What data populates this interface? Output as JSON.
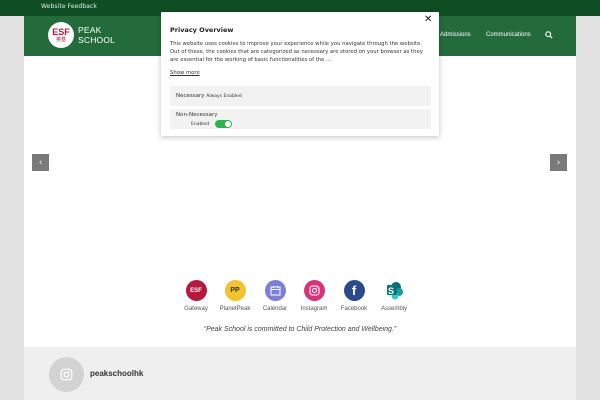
{
  "topbar": {
    "feedback_link": "Website Feedback"
  },
  "header": {
    "logo": {
      "abbr": "ESF",
      "chinese": "英基",
      "name_line1": "PEAK",
      "name_line2": "SCHOOL"
    },
    "nav": [
      {
        "label": "Admissions"
      },
      {
        "label": "Communications"
      }
    ]
  },
  "slider": {
    "prev": "‹",
    "next": "›"
  },
  "privacy_modal": {
    "title": "Privacy Overview",
    "close": "✕",
    "description": "This website uses cookies to improve your experience while you navigate through the website. Out of these, the cookies that are categorized as necessary are stored on your browser as they are essential for the working of basic functionalities of the ...",
    "show_more": "Show more",
    "preferences": [
      {
        "name": "Necessary",
        "status": "Always Enabled"
      },
      {
        "name": "Non-Necessary",
        "status": "Enabled",
        "toggle_on": true
      }
    ]
  },
  "quicklinks": [
    {
      "label": "Gateway",
      "icon": "esf-logo-icon",
      "glyph": "ESF",
      "color": "#b01c3c"
    },
    {
      "label": "PlanetPeak",
      "icon": "planetpeak-icon",
      "glyph": "PP",
      "color": "#f2c230"
    },
    {
      "label": "Calendar",
      "icon": "calendar-icon",
      "glyph": "",
      "color": "#7c7fd6"
    },
    {
      "label": "Instagram",
      "icon": "instagram-icon",
      "glyph": "",
      "color": "#d6337a"
    },
    {
      "label": "Facebook",
      "icon": "facebook-icon",
      "glyph": "f",
      "color": "#2b4a8b"
    },
    {
      "label": "Assembly",
      "icon": "sharepoint-icon",
      "glyph": "S",
      "color": "#0e8a7d"
    }
  ],
  "quote": "“Peak School is committed to Child Protection and Wellbeing.”",
  "instagram_feed": {
    "handle": "peakschoolhk"
  }
}
